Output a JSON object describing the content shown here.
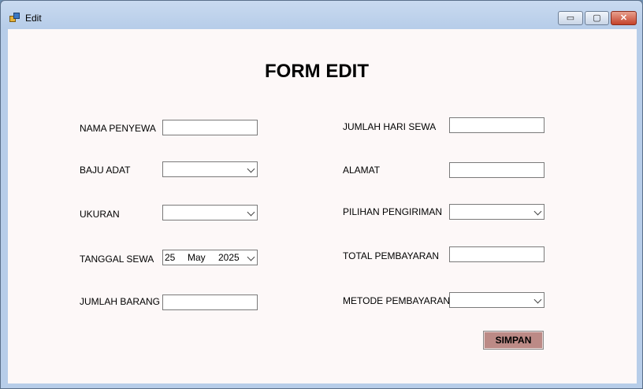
{
  "window": {
    "title": "Edit",
    "min_label": "▭",
    "max_label": "▢",
    "close_label": "✕"
  },
  "form": {
    "title": "FORM EDIT",
    "left": {
      "nama_penyewa": {
        "label": "NAMA PENYEWA",
        "value": ""
      },
      "baju_adat": {
        "label": "BAJU ADAT",
        "value": ""
      },
      "ukuran": {
        "label": "UKURAN",
        "value": ""
      },
      "tanggal_sewa": {
        "label": "TANGGAL SEWA",
        "day": "25",
        "month": "May",
        "year": "2025"
      },
      "jumlah_barang": {
        "label": "JUMLAH BARANG",
        "value": ""
      }
    },
    "right": {
      "jumlah_hari_sewa": {
        "label": "JUMLAH HARI SEWA",
        "value": ""
      },
      "alamat": {
        "label": "ALAMAT",
        "value": ""
      },
      "pilihan_pengiriman": {
        "label": "PILIHAN PENGIRIMAN",
        "value": ""
      },
      "total_pembayaran": {
        "label": "TOTAL PEMBAYARAN",
        "value": ""
      },
      "metode_pembayaran": {
        "label": "METODE PEMBAYARAN",
        "value": ""
      }
    },
    "submit_label": "SIMPAN"
  },
  "colors": {
    "client_bg": "#fdf8f8",
    "button_bg": "#bc8a86",
    "titlebar": "#c9daf0"
  }
}
